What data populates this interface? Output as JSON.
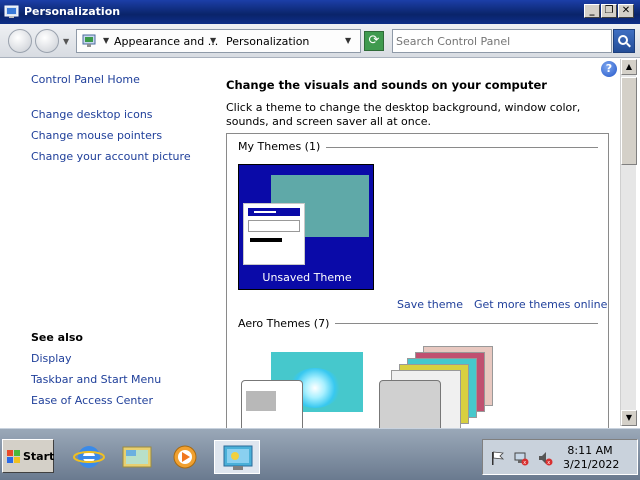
{
  "window": {
    "title": "Personalization",
    "minimize_glyph": "_",
    "restore_glyph": "❐",
    "close_glyph": "✕"
  },
  "address_bar": {
    "breadcrumbs": [
      "Appearance and ...",
      "Personalization"
    ],
    "search_placeholder": "Search Control Panel"
  },
  "left_pane": {
    "links": [
      "Control Panel Home",
      "Change desktop icons",
      "Change mouse pointers",
      "Change your account picture"
    ],
    "see_also_title": "See also",
    "see_also_links": [
      "Display",
      "Taskbar and Start Menu",
      "Ease of Access Center"
    ]
  },
  "main": {
    "heading": "Change the visuals and sounds on your computer",
    "description": "Click a theme to change the desktop background, window color, sounds, and screen saver all at once.",
    "my_themes_label": "My Themes (1)",
    "unsaved_theme_label": "Unsaved Theme",
    "save_theme_link": "Save theme",
    "get_more_link": "Get more themes online",
    "aero_themes_label": "Aero Themes (7)",
    "help_glyph": "?"
  },
  "taskbar": {
    "start_label": "Start",
    "clock_time": "8:11 AM",
    "clock_date": "3/21/2022"
  },
  "colors": {
    "titlebar": "#0a246a",
    "link": "#1f3f9a",
    "theme_tile": "#0a0aa8",
    "theme_accent": "#5fa9a8"
  },
  "icons": [
    "control-panel-icon",
    "back-icon",
    "forward-icon",
    "refresh-icon",
    "search-icon",
    "help-icon",
    "windows-flag-icon",
    "internet-explorer-icon",
    "explorer-icon",
    "media-player-icon",
    "personalization-icon",
    "action-center-flag-icon",
    "network-icon",
    "volume-icon"
  ]
}
